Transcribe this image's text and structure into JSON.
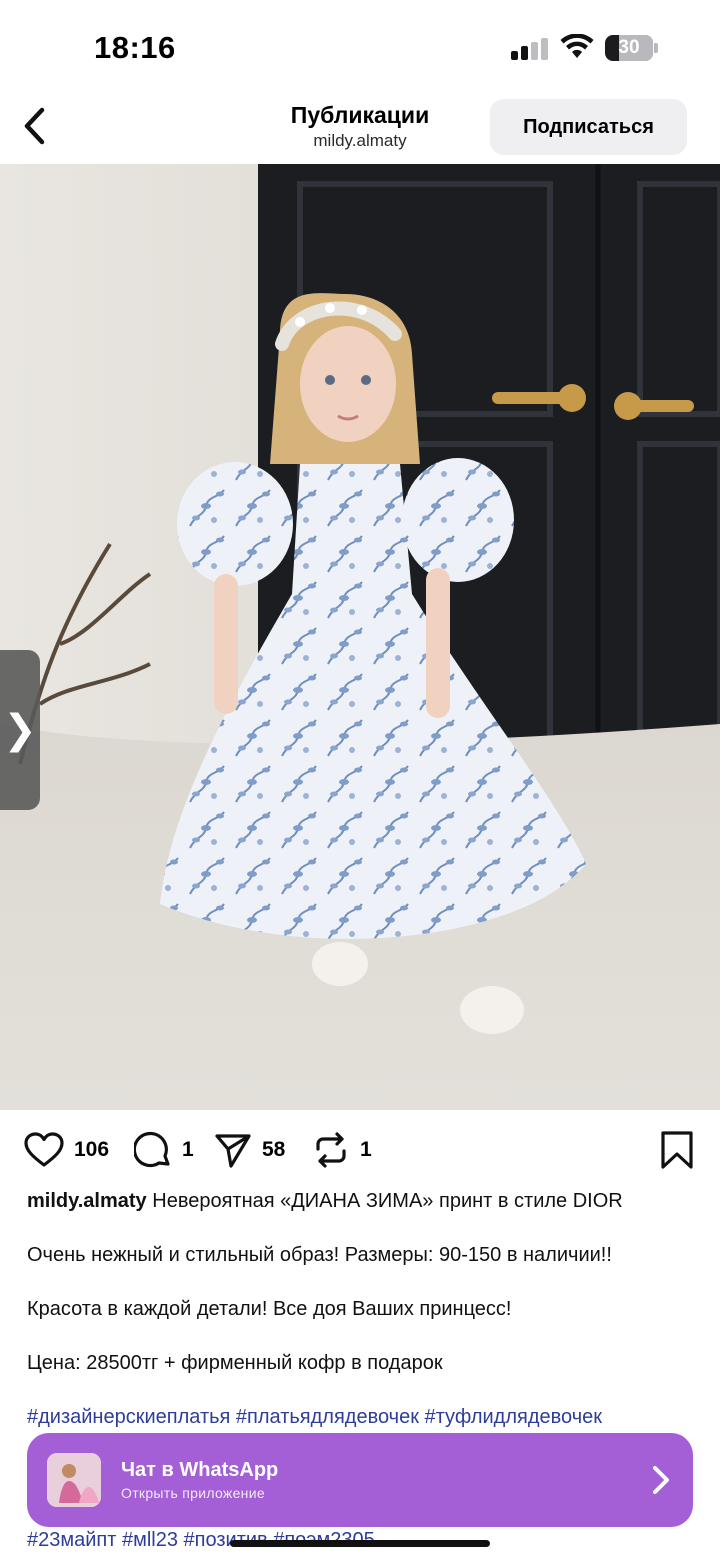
{
  "status_bar": {
    "time": "18:16",
    "battery_level": "30"
  },
  "header": {
    "title": "Публикации",
    "subtitle": "mildy.almaty",
    "follow_label": "Подписаться"
  },
  "media": {
    "side_tab_icon": "❯",
    "mute_icon": "speaker-muted-icon"
  },
  "actions": {
    "likes": "106",
    "comments": "1",
    "shares": "58",
    "reposts": "1"
  },
  "caption": {
    "author": "mildy.almaty",
    "line1": "Невероятная «ДИАНА ЗИМА» принт в стиле DIOR",
    "line2": "Очень нежный и стильный образ! Размеры: 90-150 в наличии!!",
    "line3": "Красота в каждой детали! Все доя Ваших принцесс!",
    "line4": "Цена: 28500тг + фирменный кофр в подарок",
    "hashtags": "#дизайнерскиеплатья #платьядлядевочек #туфлидлядевочек",
    "hashtags_bottom": "#23майпт #мll23 #позитив #поэм2305"
  },
  "whatsapp_banner": {
    "title": "Чат в WhatsApp",
    "subtitle": "Открыть приложение"
  },
  "colors": {
    "banner": "#a45fd6",
    "hashtag": "#2e3c9a",
    "follow_bg": "#efeff1"
  }
}
